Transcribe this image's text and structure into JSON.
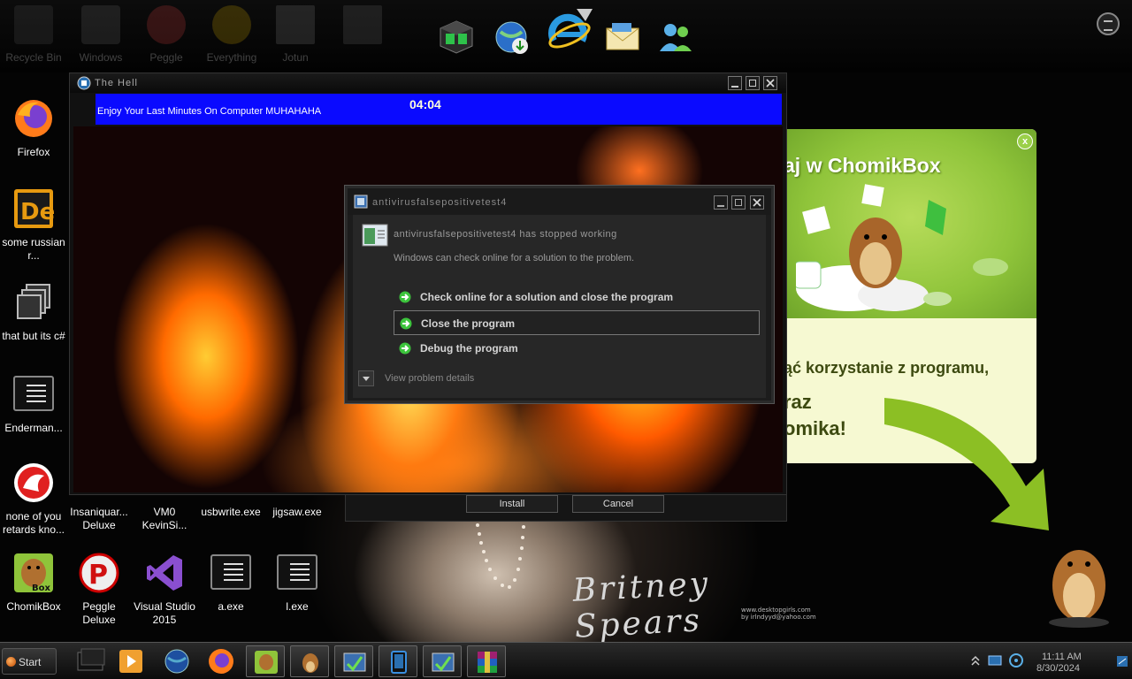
{
  "dock": {
    "faded_items": [
      {
        "label": "Recycle Bin"
      },
      {
        "label": "Windows"
      },
      {
        "label": "Peggle"
      },
      {
        "label": "Everything"
      },
      {
        "label": "Jotun"
      },
      {
        "label": ""
      }
    ]
  },
  "desktop": {
    "icons": [
      {
        "label": "Firefox"
      },
      {
        "label": "some russian r..."
      },
      {
        "label": "that but its c#"
      },
      {
        "label": "Enderman..."
      },
      {
        "label": "none of you retards kno..."
      },
      {
        "label": "ChomikBox"
      },
      {
        "label": "Insaniquar... Deluxe"
      },
      {
        "label": "VM0 KevinSi..."
      },
      {
        "label": "usbwrite.exe"
      },
      {
        "label": "jigsaw.exe"
      },
      {
        "label": "Peggle Deluxe"
      },
      {
        "label": "Visual Studio 2015"
      },
      {
        "label": "a.exe"
      },
      {
        "label": "l.exe"
      }
    ],
    "wallpaper_signature": "Britney Spears",
    "wallpaper_credit": "www.desktopgirls.com",
    "wallpaper_credit2": "by irlndyyd@yahoo.com"
  },
  "hell_window": {
    "title": "The Hell",
    "banner_text": "Enjoy Your Last Minutes On Computer MUHAHAHA",
    "timer": "04:04"
  },
  "installer": {
    "install_label": "Install",
    "cancel_label": "Cancel"
  },
  "error_dialog": {
    "title": "antivirusfalsepositivetest4",
    "heading": "antivirusfalsepositivetest4 has stopped working",
    "subtext": "Windows can check online for a solution to the problem.",
    "options": [
      {
        "label": "Check online for a solution and close the program"
      },
      {
        "label": "Close the program"
      },
      {
        "label": "Debug the program"
      }
    ],
    "details_label": "View problem details"
  },
  "chomik_ad": {
    "headline": "aj w ChomikBox",
    "line1": "ąć korzystanie z programu,",
    "line2": "raz",
    "line3": "omika!",
    "close_label": "x"
  },
  "taskbar": {
    "start_label": "Start",
    "clock_time": "11:11 AM",
    "clock_date": "8/30/2024"
  },
  "colors": {
    "banner_blue": "#0a0aff",
    "chomik_green": "#8fc43a",
    "option_arrow_green": "#3cc43c"
  }
}
